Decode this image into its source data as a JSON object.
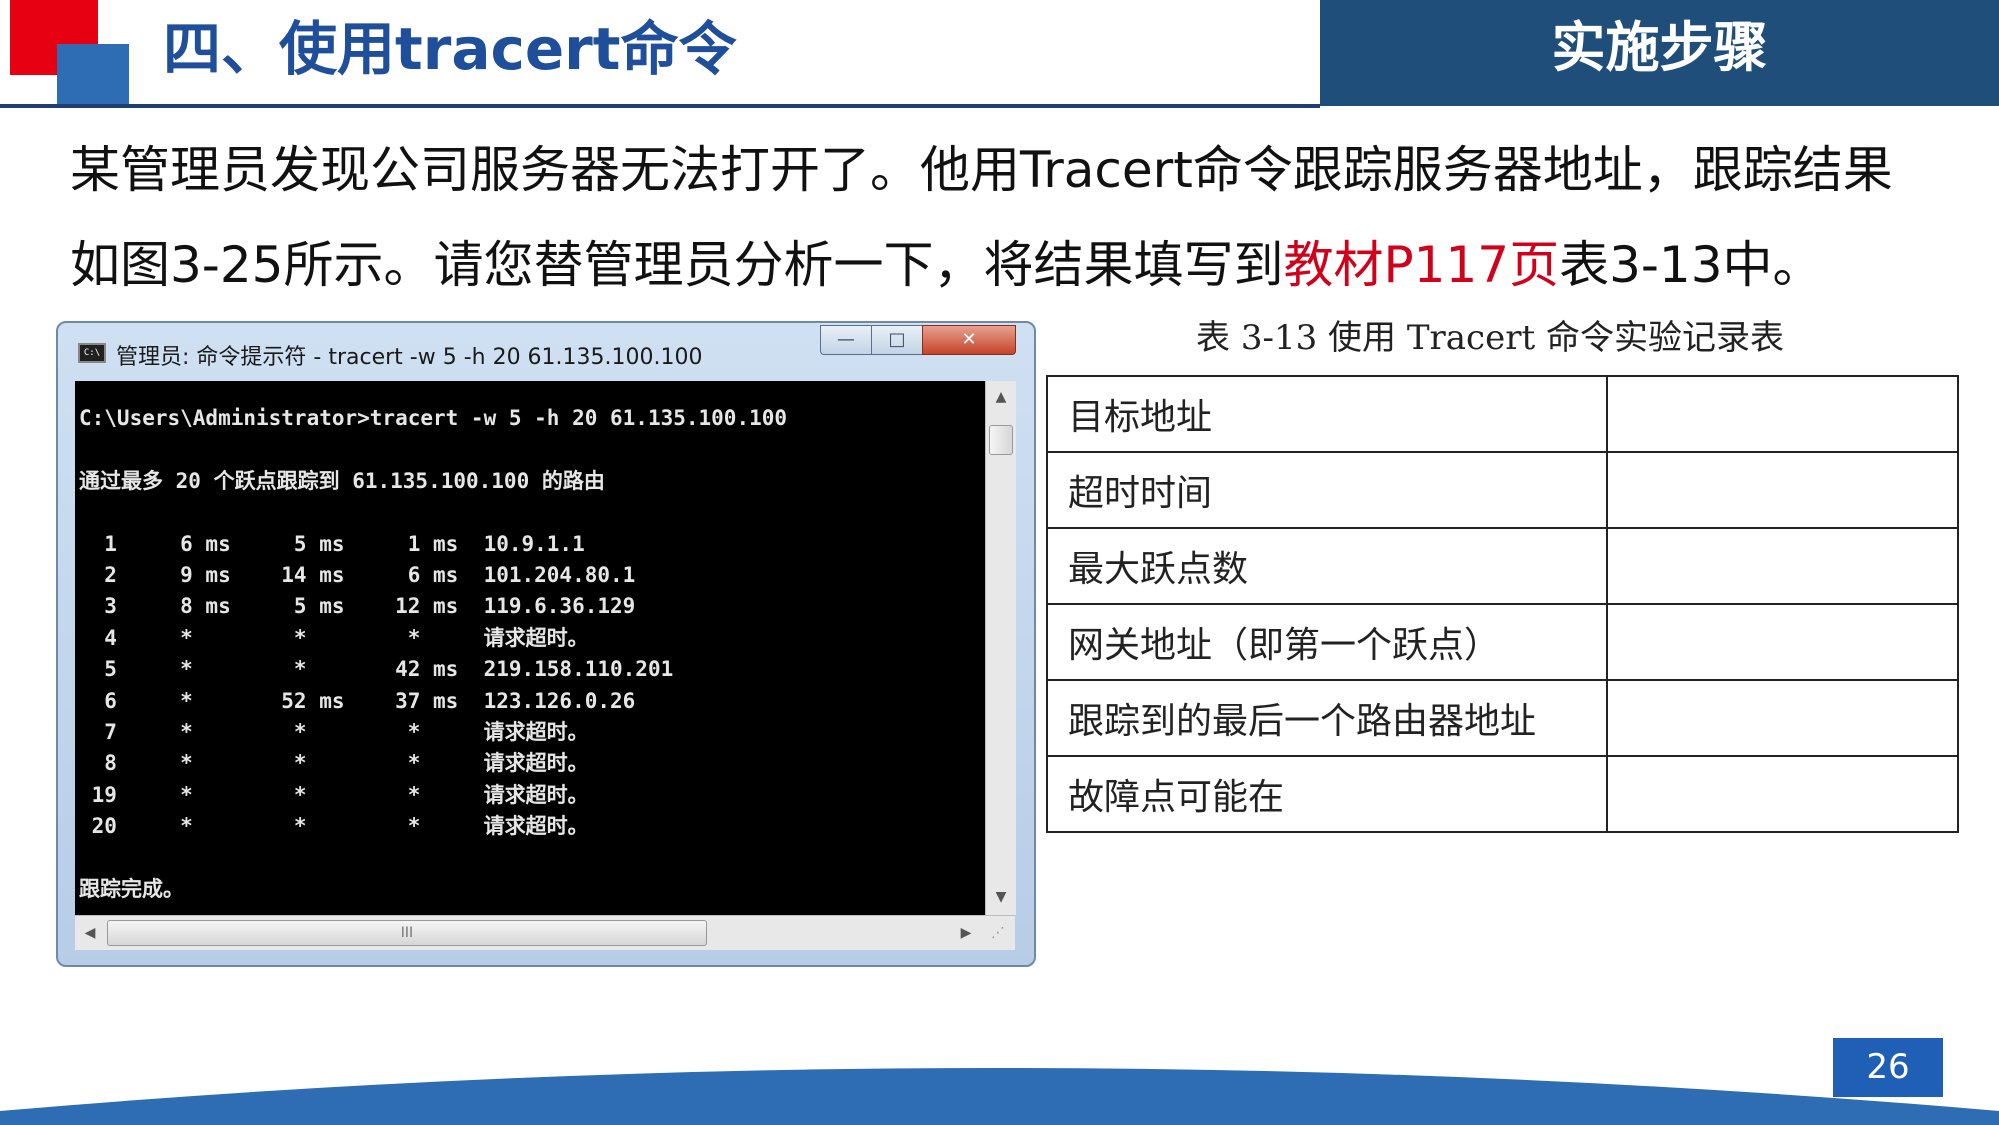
{
  "header": {
    "title": "四、使用tracert命令",
    "section": "实施步骤"
  },
  "intro": {
    "line1": "某管理员发现公司服务器无法打开了。他用Tracert命令跟踪服务器地址，跟踪结果",
    "line2_prefix": "如图3-25所示。请您替管理员分析一下，将结果填写到",
    "line2_highlight": "教材P117页",
    "line2_suffix": "表3-13中。",
    "highlight_color": "#d0021b"
  },
  "window": {
    "title": "管理员: 命令提示符 - tracert  -w 5 -h 20 61.135.100.100",
    "icon": "cmd-icon",
    "icon_text": "C:\\",
    "minimize": "—",
    "maximize": "□",
    "close": "✕",
    "scroll_up": "▲",
    "scroll_down": "▼",
    "scroll_left": "◀",
    "scroll_right": "▶",
    "hscroll_grip": "III",
    "resize_grip": "⋰"
  },
  "console": {
    "lines": [
      "C:\\Users\\Administrator>tracert -w 5 -h 20 61.135.100.100",
      "",
      "通过最多 20 个跃点跟踪到 61.135.100.100 的路由",
      "",
      "  1     6 ms     5 ms     1 ms  10.9.1.1",
      "  2     9 ms    14 ms     6 ms  101.204.80.1",
      "  3     8 ms     5 ms    12 ms  119.6.36.129",
      "  4     *        *        *     请求超时。",
      "  5     *        *       42 ms  219.158.110.201",
      "  6     *       52 ms    37 ms  123.126.0.26",
      "  7     *        *        *     请求超时。",
      "  8     *        *        *     请求超时。",
      " 19     *        *        *     请求超时。",
      " 20     *        *        *     请求超时。",
      "",
      "跟踪完成。"
    ]
  },
  "table": {
    "caption": "表 3-13  使用 Tracert 命令实验记录表",
    "rows": [
      {
        "label": "目标地址",
        "value": ""
      },
      {
        "label": "超时时间",
        "value": ""
      },
      {
        "label": "最大跃点数",
        "value": ""
      },
      {
        "label": "网关地址（即第一个跃点）",
        "value": ""
      },
      {
        "label": "跟踪到的最后一个路由器地址",
        "value": ""
      },
      {
        "label": "故障点可能在",
        "value": ""
      }
    ]
  },
  "footer": {
    "page_number": "26",
    "wave_color": "#2e6db4"
  }
}
